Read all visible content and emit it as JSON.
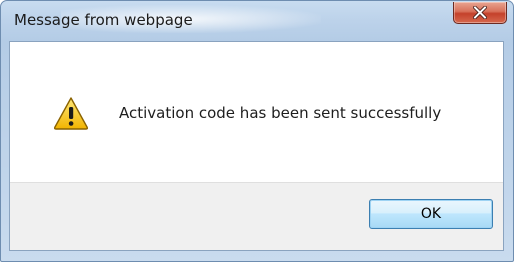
{
  "window": {
    "title": "Message from webpage",
    "close_icon": "close-icon"
  },
  "dialog": {
    "icon": "warning-icon",
    "message": "Activation code has been sent successfully"
  },
  "buttons": {
    "ok_label": "OK"
  },
  "colors": {
    "close_button": "#c4412b",
    "ok_button_border": "#3c7fb1",
    "warning_yellow": "#f7c400"
  }
}
